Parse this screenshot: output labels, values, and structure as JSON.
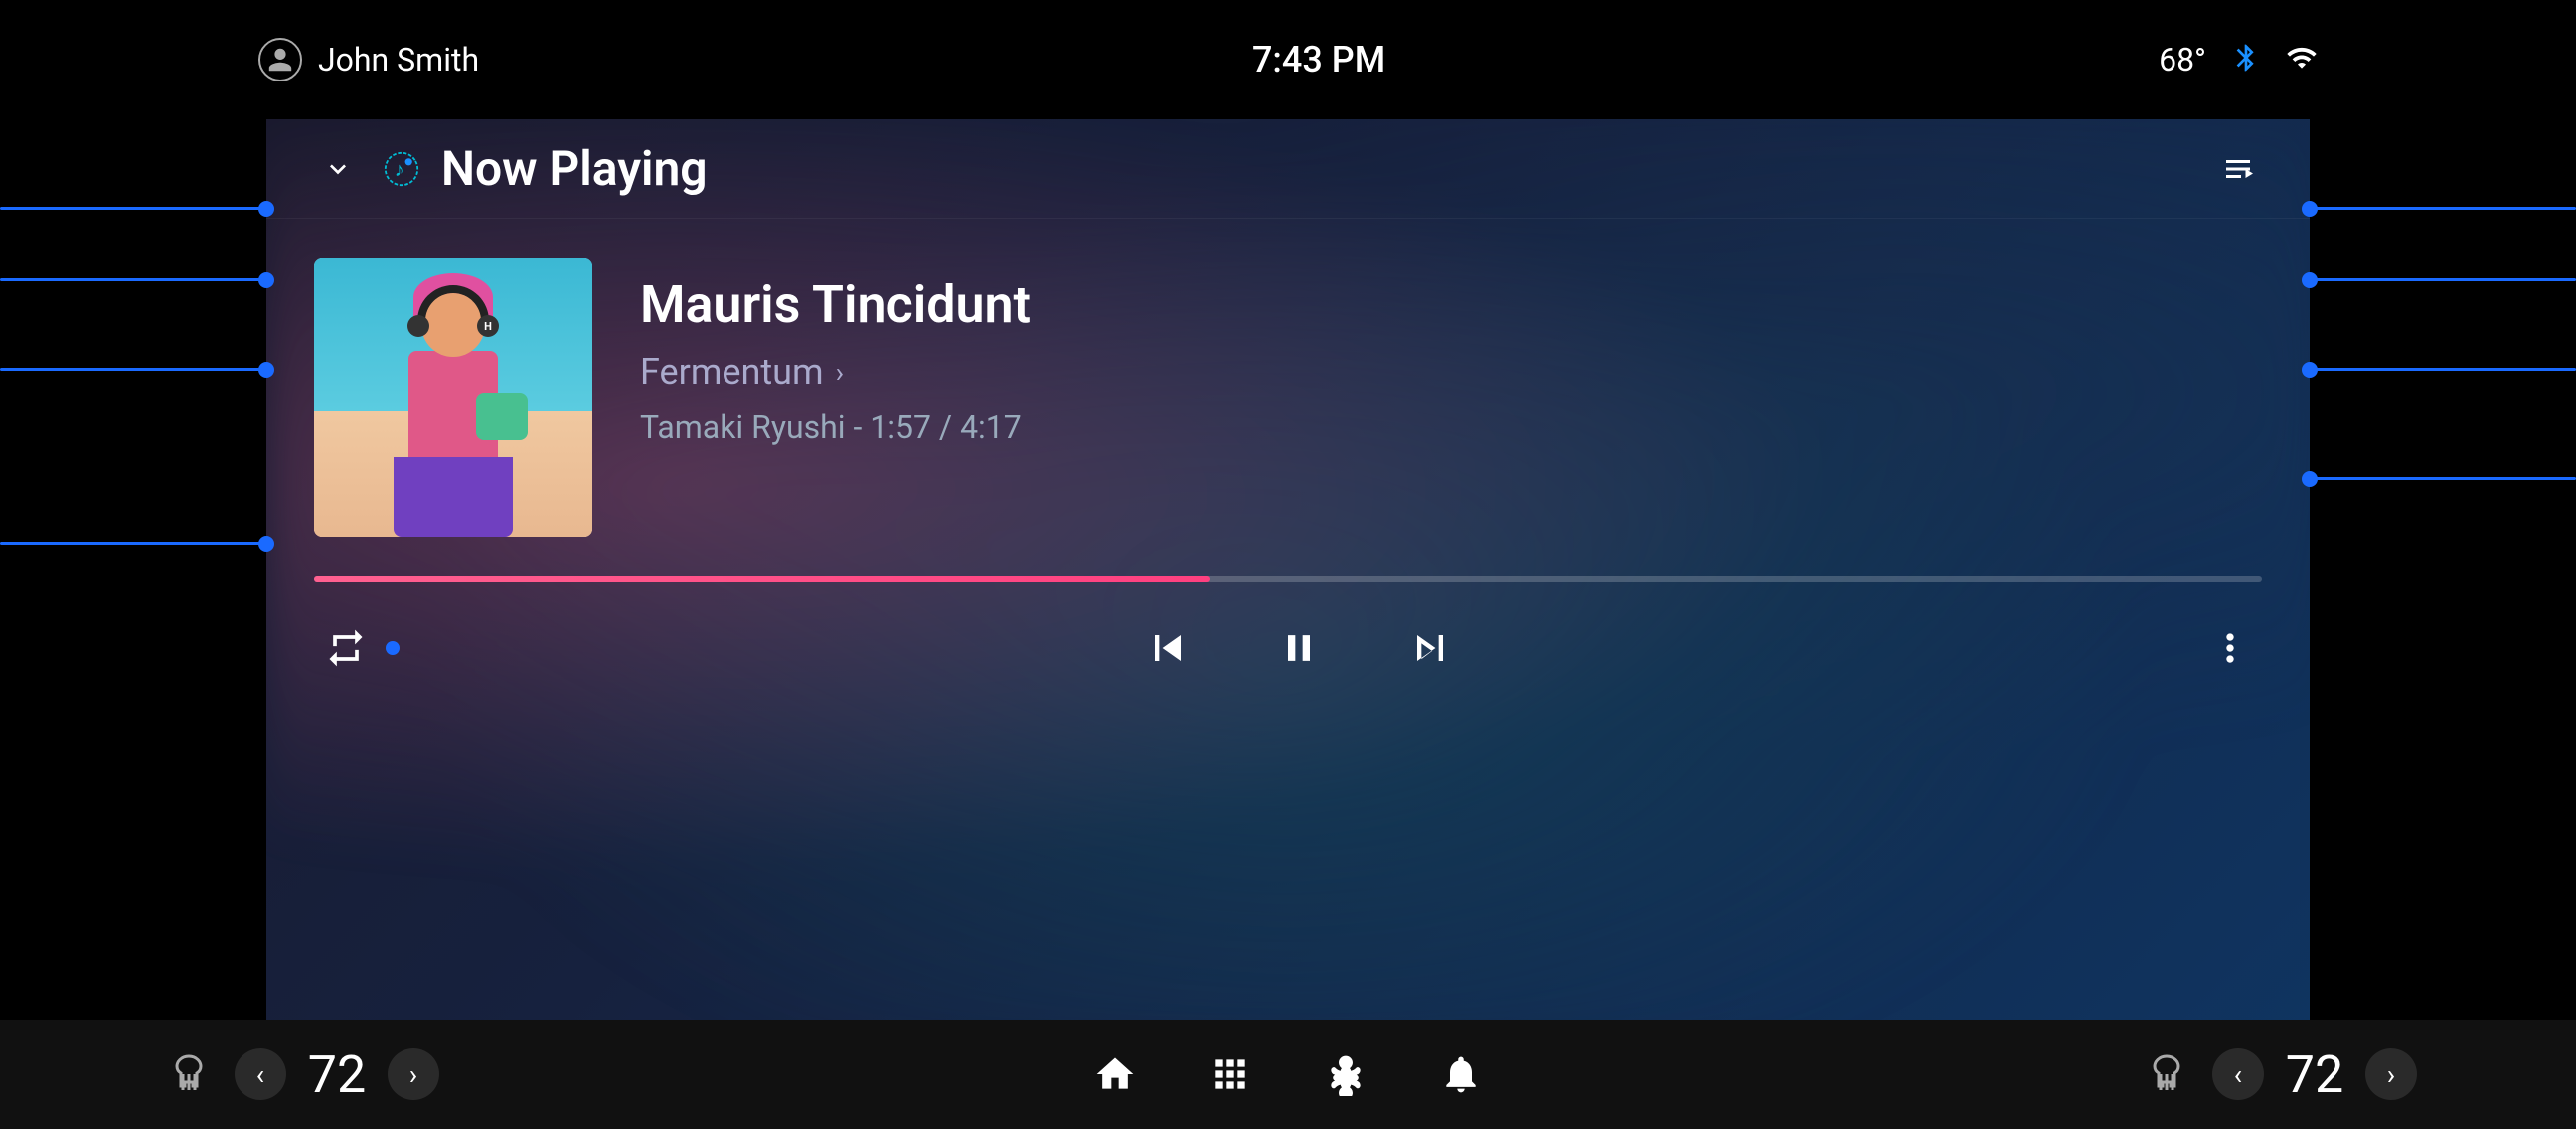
{
  "statusBar": {
    "username": "John Smith",
    "time": "7:43 PM",
    "temperature": "68°",
    "bluetooth": "bluetooth",
    "signal": "signal"
  },
  "playerHeader": {
    "chevronLabel": "▾",
    "nowPlayingLabel": "Now Playing",
    "queueIconLabel": "queue"
  },
  "track": {
    "title": "Mauris Tincidunt",
    "album": "Fermentum",
    "artistTime": "Tamaki Ryushi - 1:57 / 4:17",
    "progressPercent": 46
  },
  "controls": {
    "repeat": "repeat",
    "previous": "skip-previous",
    "pause": "pause",
    "next": "skip-next",
    "more": "more-vert"
  },
  "bottomBar": {
    "leftTemp": {
      "value": "72",
      "decreaseLabel": "‹",
      "increaseLabel": "›",
      "ventIconLabel": "vent-heated"
    },
    "nav": {
      "home": "home",
      "apps": "apps",
      "fan": "fan",
      "bell": "notifications"
    },
    "rightTemp": {
      "value": "72",
      "decreaseLabel": "‹",
      "increaseLabel": "›",
      "ventIconLabel": "vent-heated-right"
    }
  }
}
